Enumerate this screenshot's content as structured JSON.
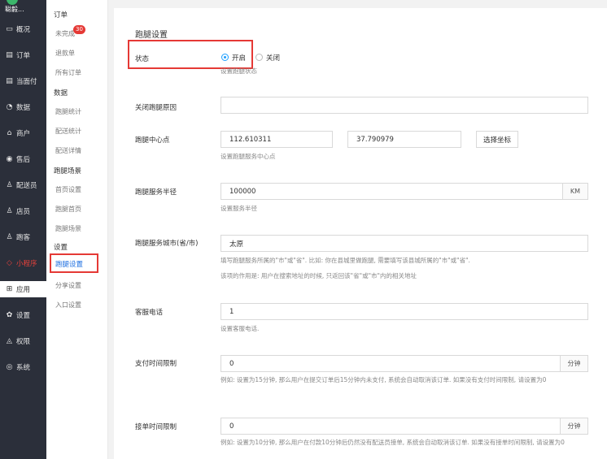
{
  "sidebar": {
    "brand": "聪毅...",
    "items": [
      {
        "label": "概况",
        "icon": "layout-icon"
      },
      {
        "label": "订单",
        "icon": "list-icon"
      },
      {
        "label": "当面付",
        "icon": "list-icon"
      },
      {
        "label": "数据",
        "icon": "chart-circle-icon"
      },
      {
        "label": "商户",
        "icon": "store-icon"
      },
      {
        "label": "售后",
        "icon": "service-icon"
      },
      {
        "label": "配送员",
        "icon": "person-icon"
      },
      {
        "label": "店员",
        "icon": "person-icon"
      },
      {
        "label": "跑客",
        "icon": "person-icon"
      },
      {
        "label": "小程序",
        "icon": "miniapp-icon"
      },
      {
        "label": "应用",
        "icon": "apps-icon"
      },
      {
        "label": "设置",
        "icon": "gear-icon"
      },
      {
        "label": "权限",
        "icon": "lock-icon"
      },
      {
        "label": "系统",
        "icon": "system-icon"
      }
    ]
  },
  "submenu": {
    "orders_title": "订单",
    "unfinished": "未完成",
    "unfinished_badge": "30",
    "refund": "退款单",
    "all_orders": "所有订单",
    "data_title": "数据",
    "errand_stats": "跑腿统计",
    "delivery_stats": "配送统计",
    "delivery_detail": "配送详情",
    "scene_title": "跑腿场景",
    "home_settings": "首页设置",
    "errand_home": "跑腿首页",
    "errand_scene": "跑腿场景",
    "settings_title": "设置",
    "errand_settings": "跑腿设置",
    "share_settings": "分享设置",
    "entry_settings": "入口设置"
  },
  "form": {
    "section_title": "跑腿设置",
    "status_label": "状态",
    "status_on": "开启",
    "status_off": "关闭",
    "status_help": "设置跑腿状态",
    "close_reason_label": "关闭跑腿原因",
    "close_reason_value": "",
    "center_label": "跑腿中心点",
    "center_lng": "112.610311",
    "center_lat": "37.790979",
    "select_coord": "选择坐标",
    "center_help": "设置跑腿服务中心点",
    "radius_label": "跑腿服务半径",
    "radius_value": "100000",
    "radius_unit": "KM",
    "radius_help": "设置服务半径",
    "city_label": "跑腿服务城市(省/市)",
    "city_value": "太原",
    "city_help1": "填写跑腿服务所属的\"市\"或\"省\". 比如: 你在县城里做跑腿, 需要填写该县城所属的\"市\"或\"省\".",
    "city_help2": "该项的作用是: 用户在搜索地址的时候, 只返回该\"省\"或\"市\"内的相关地址",
    "phone_label": "客服电话",
    "phone_value": "1",
    "phone_help": "设置客服电话.",
    "pay_limit_label": "支付时间限制",
    "pay_limit_value": "0",
    "pay_limit_unit": "分钟",
    "pay_limit_help": "例如: 设置为15分钟, 那么用户在提交订单后15分钟内未支付, 系统会自动取消该订单. 如果没有支付时间限制, 请设置为0",
    "accept_limit_label": "接单时间限制",
    "accept_limit_value": "0",
    "accept_limit_unit": "分钟",
    "accept_limit_help": "例如: 设置为10分钟, 那么用户在付款10分钟后仍然没有配送员接单, 系统会自动取消该订单. 如果没有接单时间限制, 请设置为0"
  }
}
